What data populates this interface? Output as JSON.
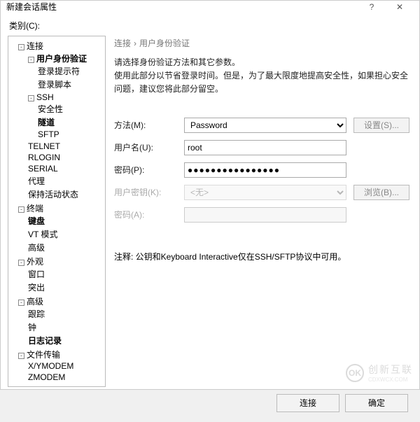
{
  "window": {
    "title": "新建会话属性"
  },
  "category_label": "类别(C):",
  "tree": {
    "connection": {
      "label": "连接",
      "user_auth": {
        "label": "用户身份验证",
        "bold": true,
        "login_hint": "登录提示符",
        "login_script": "登录脚本"
      },
      "ssh": {
        "label": "SSH",
        "security": "安全性",
        "tunnel": {
          "label": "隧道",
          "bold": true
        },
        "sftp": "SFTP"
      },
      "telnet": "TELNET",
      "rlogin": "RLOGIN",
      "serial": "SERIAL",
      "proxy": "代理",
      "keep_alive": "保持活动状态"
    },
    "terminal": {
      "label": "终端",
      "keyboard": {
        "label": "键盘",
        "bold": true
      },
      "vt_mode": "VT 模式",
      "advanced": "高级"
    },
    "appearance": {
      "label": "外观",
      "window": "窗口",
      "highlight": "突出"
    },
    "advanced": {
      "label": "高级",
      "trace": "跟踪",
      "bell": "钟",
      "logging": {
        "label": "日志记录",
        "bold": true
      }
    },
    "file_transfer": {
      "label": "文件传输",
      "xymodem": "X/YMODEM",
      "zmodem": "ZMODEM"
    }
  },
  "breadcrumb": {
    "a": "连接",
    "b": "用户身份验证"
  },
  "desc": {
    "line1": "请选择身份验证方法和其它参数。",
    "line2": "使用此部分以节省登录时间。但是，为了最大限度地提高安全性，如果担心安全问题，建议您将此部分留空。"
  },
  "form": {
    "method_label": "方法(M):",
    "method_value": "Password",
    "settings_btn": "设置(S)...",
    "username_label": "用户名(U):",
    "username_value": "root",
    "password_label": "密码(P):",
    "password_value": "●●●●●●●●●●●●●●●●",
    "userkey_label": "用户密钥(K):",
    "userkey_value": "<无>",
    "browse_btn": "浏览(B)...",
    "passphrase_label": "密码(A):"
  },
  "note": "注释: 公钥和Keyboard Interactive仅在SSH/SFTP协议中可用。",
  "footer": {
    "connect": "连接",
    "ok": "确定"
  },
  "watermark": {
    "logo": "OK",
    "name": "创新互联",
    "sub": "CDXWCX.COM"
  }
}
